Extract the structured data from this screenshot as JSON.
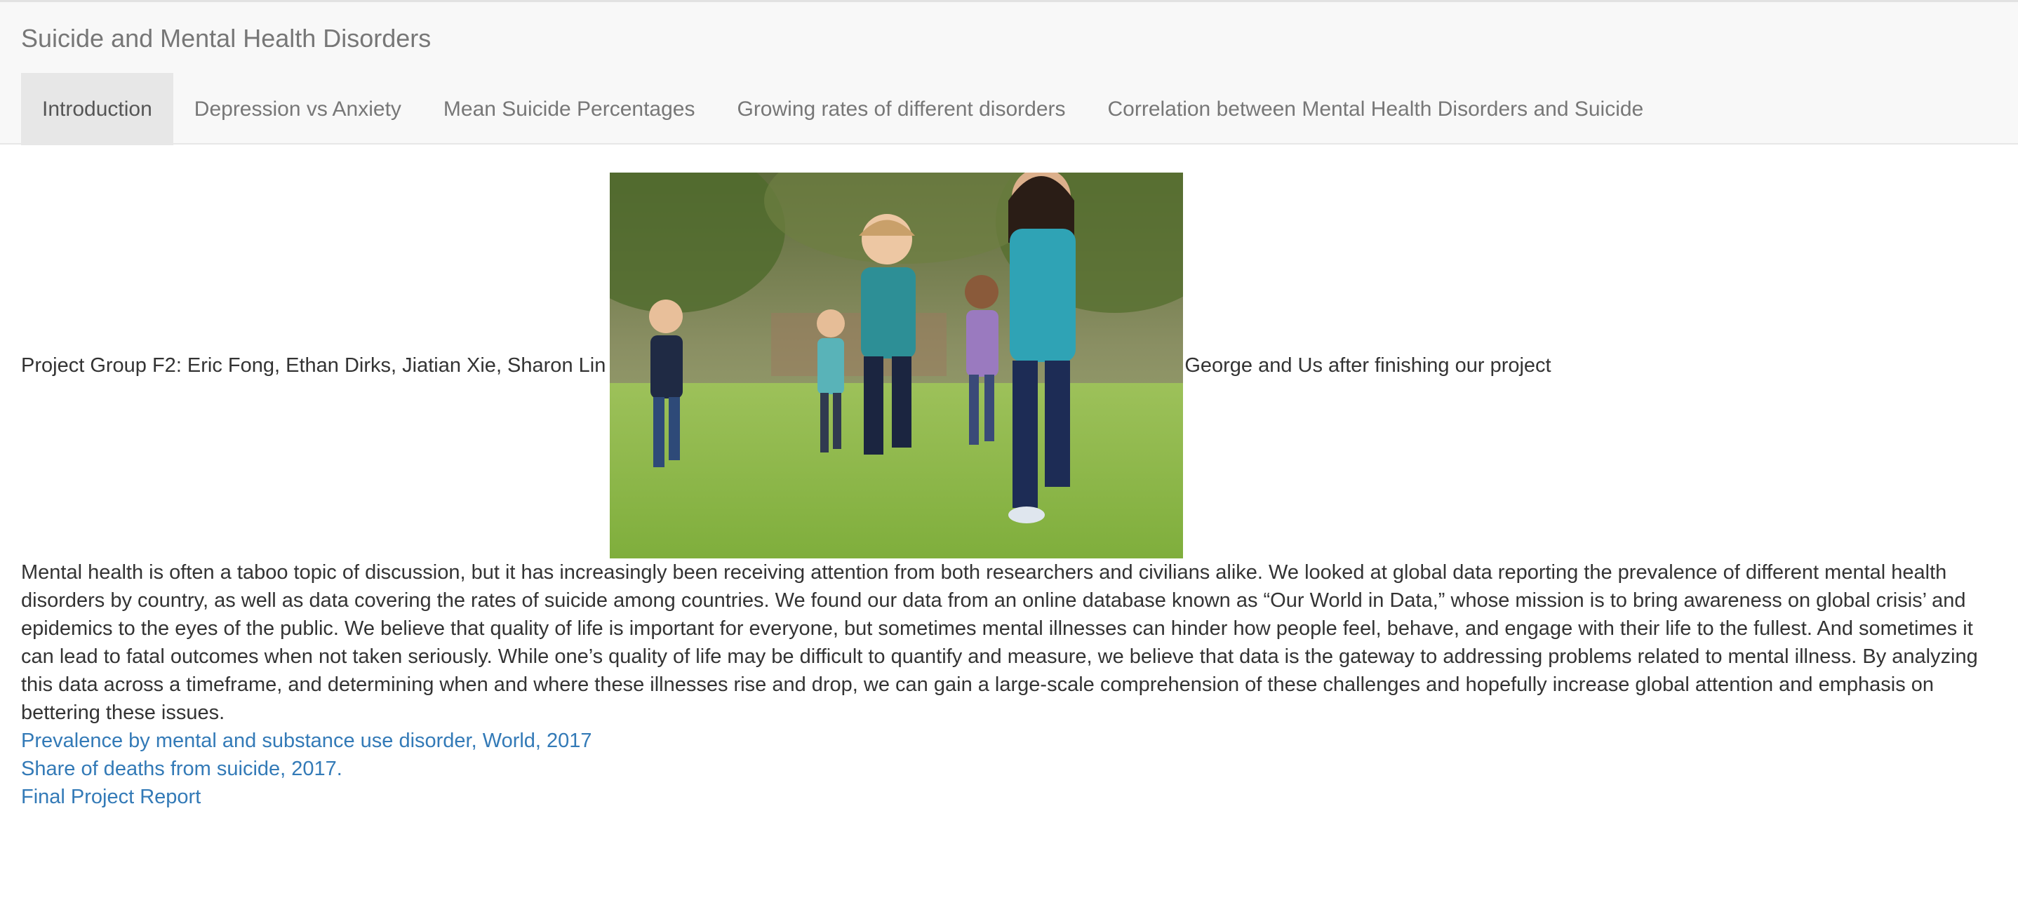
{
  "app": {
    "title": "Suicide and Mental Health Disorders"
  },
  "tabs": [
    {
      "label": "Introduction",
      "active": true
    },
    {
      "label": "Depression vs Anxiety",
      "active": false
    },
    {
      "label": "Mean Suicide Percentages",
      "active": false
    },
    {
      "label": "Growing rates of different disorders",
      "active": false
    },
    {
      "label": "Correlation between Mental Health Disorders and Suicide",
      "active": false
    }
  ],
  "intro": {
    "group_text": "Project Group F2: Eric Fong, Ethan Dirks, Jiatian Xie, Sharon Lin",
    "image_caption": "George and Us after finishing our project",
    "paragraph": "Mental health is often a taboo topic of discussion, but it has increasingly been receiving attention from both researchers and civilians alike. We looked at global data reporting the prevalence of different mental health disorders by country, as well as data covering the rates of suicide among countries. We found our data from an online database known as “Our World in Data,” whose mission is to bring awareness on global crisis’ and epidemics to the eyes of the public. We believe that quality of life is important for everyone, but sometimes mental illnesses can hinder how people feel, behave, and engage with their life to the fullest. And sometimes it can lead to fatal outcomes when not taken seriously. While one’s quality of life may be difficult to quantify and measure, we believe that data is the gateway to addressing problems related to mental illness. By analyzing this data across a timeframe, and determining when and where these illnesses rise and drop, we can gain a large-scale comprehension of these challenges and hopefully increase global attention and emphasis on bettering these issues."
  },
  "links": [
    {
      "label": "Prevalence by mental and substance use disorder, World, 2017"
    },
    {
      "label": "Share of deaths from suicide, 2017."
    },
    {
      "label": "Final Project Report"
    }
  ],
  "colors": {
    "navbar_bg": "#f8f8f8",
    "active_tab_bg": "#e7e7e7",
    "link": "#337ab7",
    "text": "#333333"
  }
}
